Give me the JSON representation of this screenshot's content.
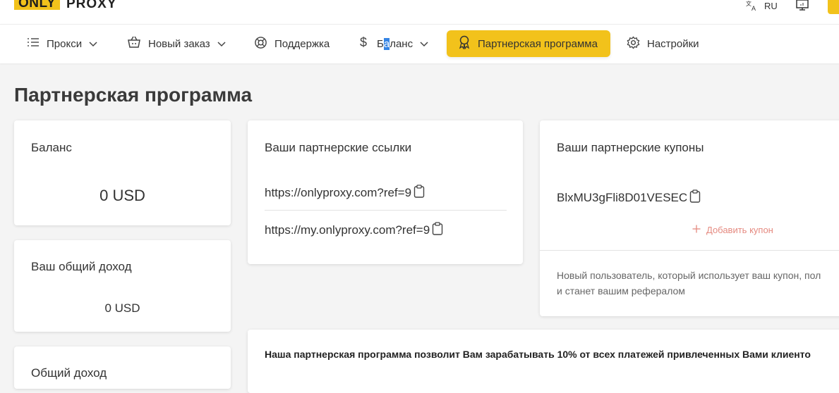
{
  "logo": {
    "part1": "ONLY",
    "part2": "PROXY"
  },
  "header": {
    "language": "RU"
  },
  "nav": {
    "items": [
      {
        "label": "Прокси"
      },
      {
        "label": "Новый заказ"
      },
      {
        "label": "Поддержка"
      },
      {
        "label_sel": "а",
        "label_pre": "Б",
        "label_post": "ланс"
      },
      {
        "label": "Партнерская программа"
      },
      {
        "label": "Настройки"
      }
    ]
  },
  "page": {
    "title": "Партнерская программа"
  },
  "balance": {
    "label": "Баланс",
    "value": "0 USD"
  },
  "total_income": {
    "label": "Ваш общий доход",
    "value": "0 USD"
  },
  "overall_income": {
    "label": "Общий доход"
  },
  "links": {
    "title": "Ваши партнерские ссылки",
    "items": [
      "https://onlyproxy.com?ref=9",
      "https://my.onlyproxy.com?ref=9"
    ]
  },
  "coupons": {
    "title": "Ваши партнерские купоны",
    "code": "BlxMU3gFli8D01VESEC",
    "add_label": "Добавить купон",
    "note_line1": "Новый пользователь, который использует ваш купон, пол",
    "note_line2": "и станет вашим рефералом"
  },
  "info": {
    "text": "Наша партнерская программа позволит Вам зарабатывать 10% от всех платежей привлеченных Вами клиенто"
  },
  "colors": {
    "accent": "#f2c21b",
    "add_coupon": "#e58a80",
    "selection": "#3584e4"
  },
  "icons": [
    "list-icon",
    "chevron-down-icon",
    "basket-icon",
    "lifebuoy-icon",
    "dollar-icon",
    "award-icon",
    "gear-icon",
    "translate-icon",
    "monitor-icon",
    "clipboard-icon",
    "plus-icon"
  ]
}
